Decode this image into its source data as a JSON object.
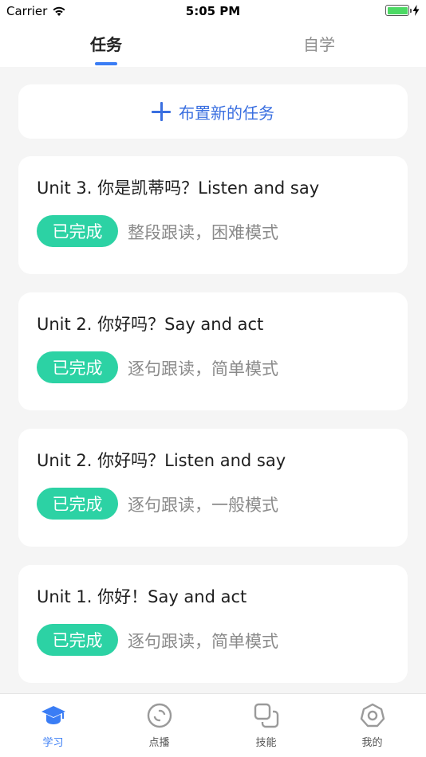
{
  "status_bar": {
    "carrier": "Carrier",
    "time": "5:05 PM"
  },
  "top_tabs": [
    {
      "label": "任务",
      "active": true
    },
    {
      "label": "自学",
      "active": false
    }
  ],
  "new_task": {
    "label": "布置新的任务"
  },
  "tasks": [
    {
      "title": "Unit  3.  你是凯蒂吗？Listen and say",
      "status": "已完成",
      "mode": "整段跟读，困难模式"
    },
    {
      "title": "Unit  2.  你好吗？Say and act",
      "status": "已完成",
      "mode": "逐句跟读，简单模式"
    },
    {
      "title": "Unit  2.  你好吗？Listen and say",
      "status": "已完成",
      "mode": "逐句跟读，一般模式"
    },
    {
      "title": "Unit  1.  你好！Say and act",
      "status": "已完成",
      "mode": "逐句跟读，简单模式"
    }
  ],
  "bottom_nav": [
    {
      "label": "学习",
      "icon": "graduation-cap-icon",
      "active": true
    },
    {
      "label": "点播",
      "icon": "disc-icon",
      "active": false
    },
    {
      "label": "技能",
      "icon": "copy-squares-icon",
      "active": false
    },
    {
      "label": "我的",
      "icon": "profile-circle-icon",
      "active": false
    }
  ],
  "colors": {
    "accent": "#3a7df5",
    "badge": "#2cd2a4",
    "background": "#f5f5f5"
  }
}
